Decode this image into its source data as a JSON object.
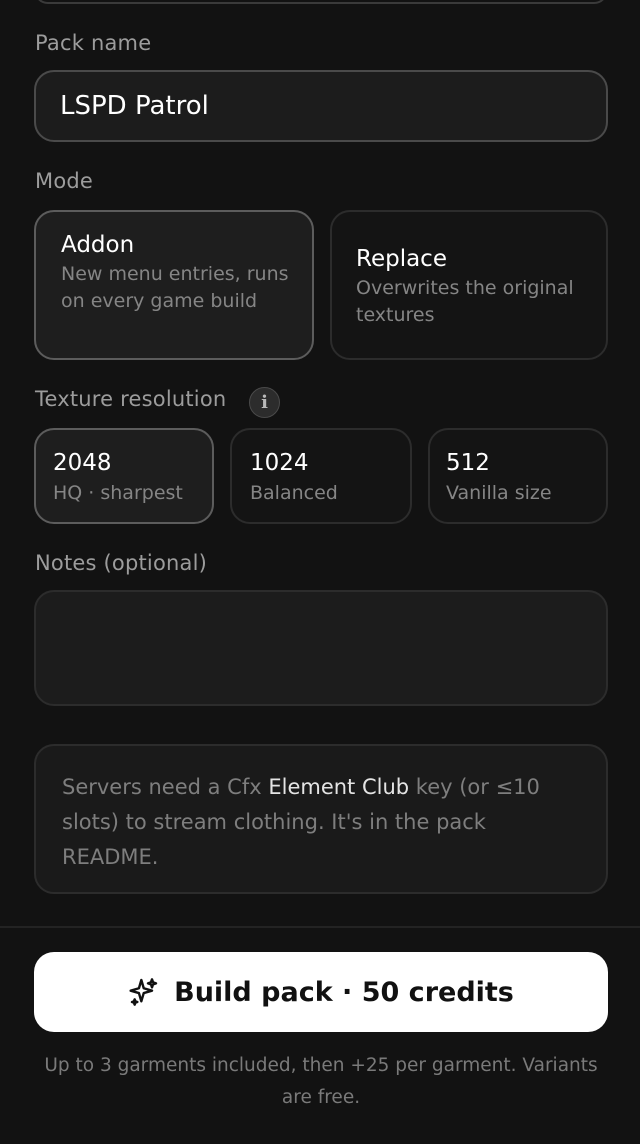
{
  "pack_name": {
    "label": "Pack name",
    "value": "LSPD Patrol"
  },
  "mode": {
    "label": "Mode",
    "options": [
      {
        "title": "Addon",
        "description": "New menu entries, runs on every game build",
        "selected": true
      },
      {
        "title": "Replace",
        "description": "Overwrites the original textures",
        "selected": false
      }
    ]
  },
  "texture_resolution": {
    "label": "Texture resolution",
    "info_glyph": "i",
    "options": [
      {
        "title": "2048",
        "description": "HQ · sharpest",
        "selected": true
      },
      {
        "title": "1024",
        "description": "Balanced",
        "selected": false
      },
      {
        "title": "512",
        "description": "Vanilla size",
        "selected": false
      }
    ]
  },
  "notes": {
    "label": "Notes (optional)",
    "value": ""
  },
  "info": {
    "part1": "Servers need a Cfx ",
    "highlight": "Element Club",
    "part2": " key (or ≤10 slots) to stream clothing. It's in the pack README."
  },
  "build_button": {
    "label": "Build pack · 50 credits",
    "icon": "sparkles-icon"
  },
  "footnote": "Up to 3 garments included, then +25 per garment. Variants are free.",
  "colors": {
    "background": "#121212",
    "accent_button": "#ffffff"
  }
}
